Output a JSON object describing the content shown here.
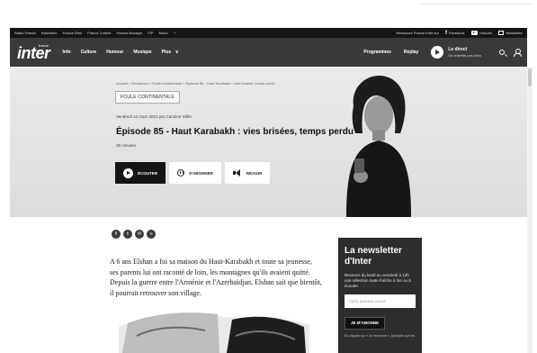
{
  "radio_france_bar": {
    "links": [
      "Radio France",
      "franceinfo",
      "France Bleu",
      "France Culture",
      "France Musique",
      "FIP",
      "Mouv'",
      "+"
    ],
    "retrouvez": "Retrouvez France Inter sur",
    "facebook": "Facebook",
    "youtube": "Youtube",
    "newsletter": "Newsletter"
  },
  "nav": {
    "logo": "inter",
    "logo_small": "france",
    "items": [
      "Info",
      "Culture",
      "Humour",
      "Musique",
      "Plus"
    ],
    "plus_chevron": "∨",
    "programmes": "Programmes",
    "replay": "Replay",
    "direct_label": "Le direct",
    "direct_sub": "On n'arrête pas l'éco"
  },
  "hero": {
    "breadcrumb": "Accueil  >  Émissions  >  Foule continentale  >  Épisode 85 - Haut Karabakh : vies brisées, temps perdu",
    "show_tag": "FOULE CONTINENTALE",
    "date_line": "Vendredi 12 mars 2021 par Caroline Gillet",
    "title": "Épisode 85 - Haut Karabakh : vies brisées, temps perdu",
    "duration": "38 minutes",
    "listen": "ÉCOUTER",
    "subscribe": "S'ABONNER",
    "react": "RÉAGIR"
  },
  "share": [
    "f",
    "t",
    "✉",
    "‹›"
  ],
  "article": {
    "paragraph": "A 6 ans Elshan a fui sa maison du Haut-Karabakh et toute sa jeunesse, ses parents lui ont raconté de loin, les montagnes qu'ils avaient quitté. Depuis la guerre entre l'Arménie et l'Azerbaïdjan, Elshan sait que bientôt, il pourrait retrouver son village."
  },
  "newsletter": {
    "title": "La newsletter d'Inter",
    "description": "Recevez du lundi au vendredi à 12h une sélection toute fraîche à lire ou à écouter.",
    "email_placeholder": "Votre adresse email",
    "subscribe_btn": "JE M'ABONNE",
    "legal": "En cliquant sur « Je m'abonne », j'accepte que les"
  },
  "colors": {
    "topbar": "#151515",
    "nav": "#3a3a3a",
    "hero_bg": "#e2e2e2",
    "newsletter_bg": "#2d2d2d"
  }
}
